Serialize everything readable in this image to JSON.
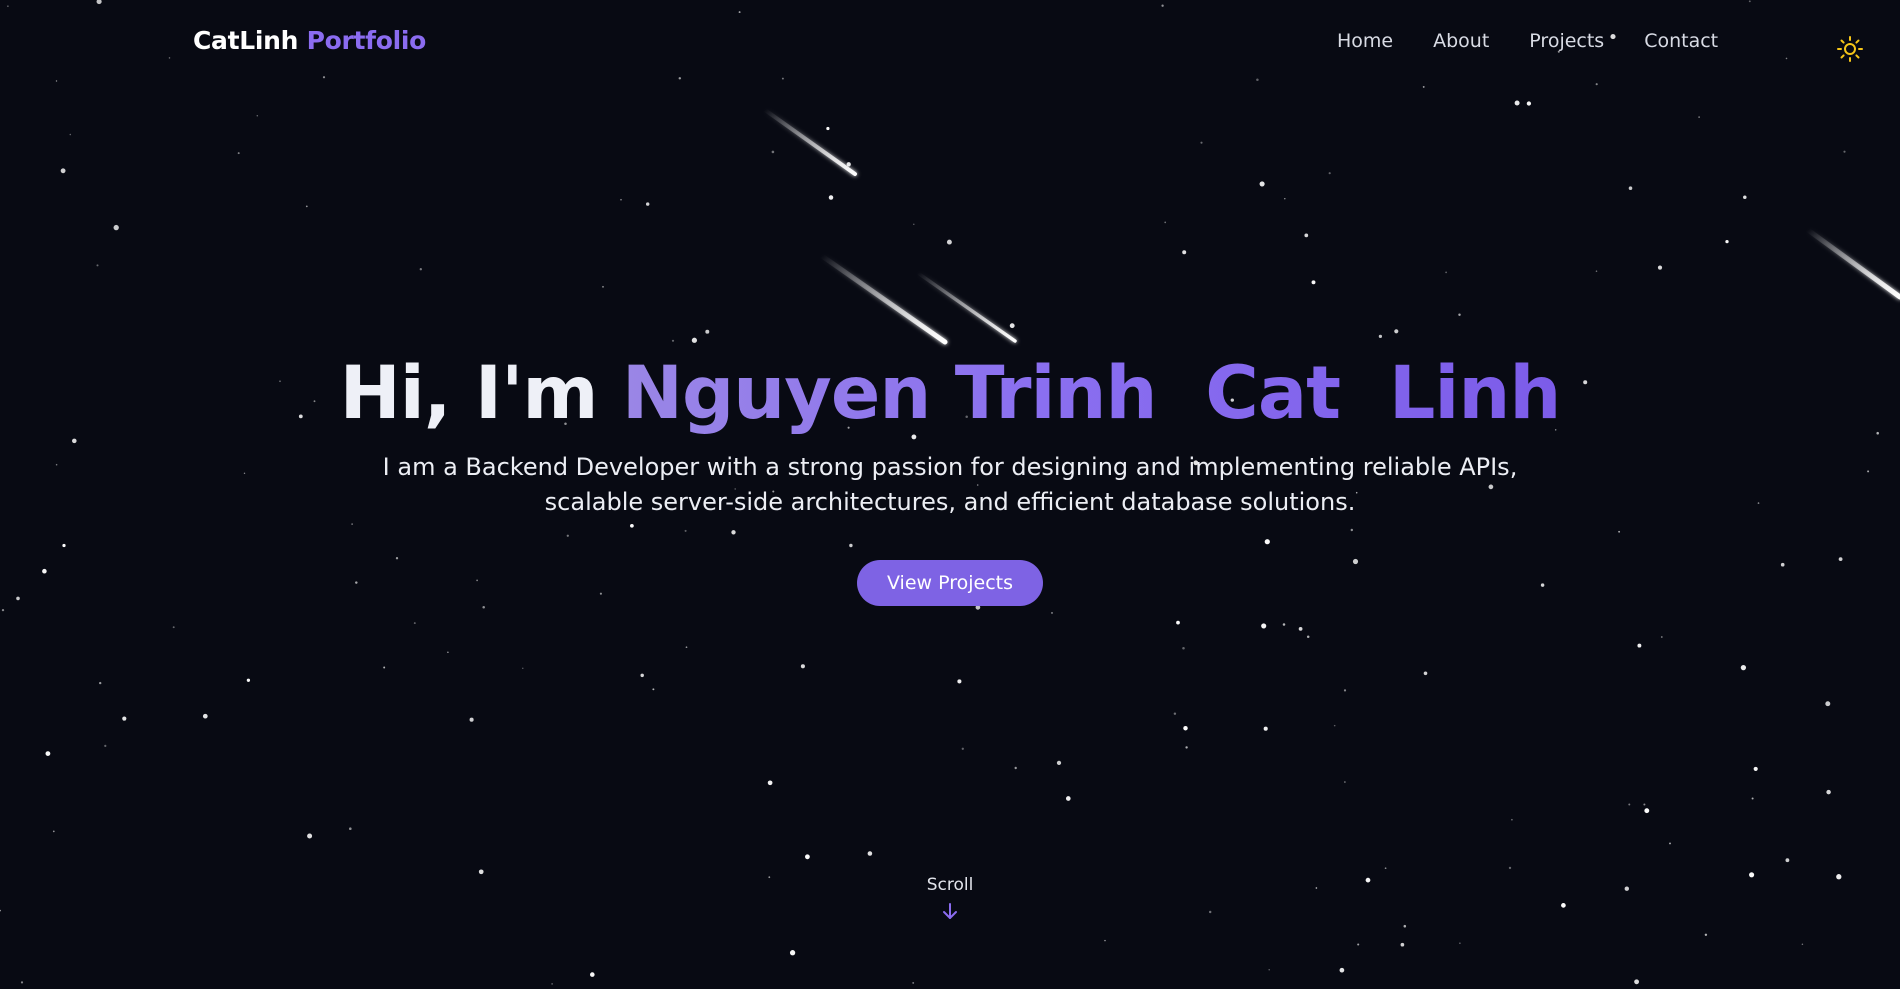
{
  "header": {
    "logo_main": "CatLinh",
    "logo_accent": "Portfolio",
    "nav": [
      {
        "label": "Home"
      },
      {
        "label": "About"
      },
      {
        "label": "Projects"
      },
      {
        "label": "Contact"
      }
    ],
    "theme_icon": "sun-icon"
  },
  "hero": {
    "greeting": "Hi, I'm",
    "name": "Nguyen Trinh  Cat  Linh",
    "subtitle": "I am a Backend Developer with a strong passion for designing and implementing reliable APIs, scalable server-side architectures, and efficient database solutions.",
    "cta_label": "View Projects"
  },
  "scroll": {
    "label": "Scroll",
    "icon": "arrow-down-icon"
  },
  "colors": {
    "background": "#080a13",
    "accent": "#7e63e4",
    "theme_icon": "#f5c518"
  }
}
